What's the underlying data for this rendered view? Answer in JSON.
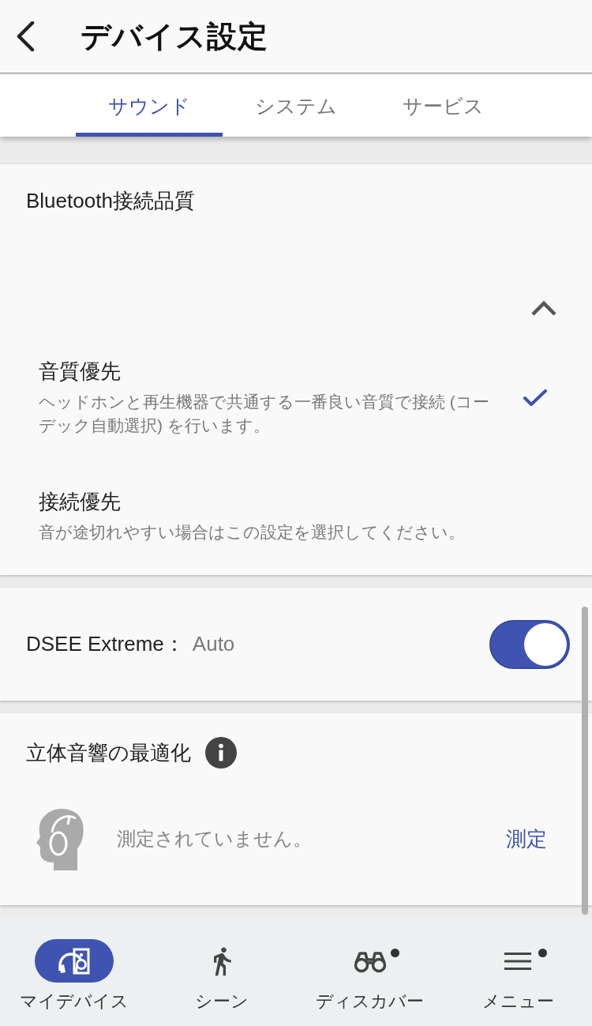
{
  "header": {
    "title": "デバイス設定"
  },
  "tabs": [
    {
      "label": "サウンド",
      "selected": true
    },
    {
      "label": "システム",
      "selected": false
    },
    {
      "label": "サービス",
      "selected": false
    }
  ],
  "sections": [
    {
      "kind": "choice",
      "title": "Bluetooth接続品質",
      "expanded": true,
      "options": [
        {
          "title": "音質優先",
          "description": "ヘッドホンと再生機器で共通する一番良い音質で接続 (コーデック自動選択) を行います。",
          "selected": true
        },
        {
          "title": "接続優先",
          "description": "音が途切れやすい場合はこの設定を選択してください。",
          "selected": false
        }
      ]
    },
    {
      "kind": "toggle",
      "label": "DSEE Extreme：",
      "value": "Auto",
      "on": true
    },
    {
      "kind": "measure",
      "title": "立体音響の最適化",
      "status": "測定されていません。",
      "action": "測定"
    }
  ],
  "bottom_nav": [
    {
      "label": "マイデバイス",
      "selected": true,
      "badge": false
    },
    {
      "label": "シーン",
      "selected": false,
      "badge": false
    },
    {
      "label": "ディスカバー",
      "selected": false,
      "badge": true
    },
    {
      "label": "メニュー",
      "selected": false,
      "badge": true
    }
  ]
}
